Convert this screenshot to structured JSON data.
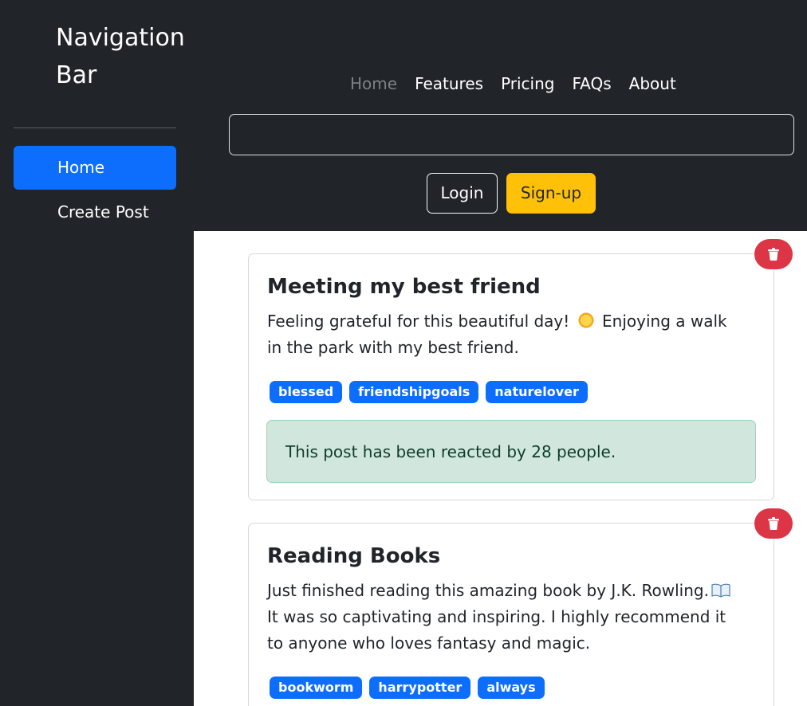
{
  "sidebar": {
    "brand": "Navigation Bar",
    "items": [
      {
        "label": "Home"
      },
      {
        "label": "Create Post"
      }
    ]
  },
  "header": {
    "nav": [
      "Home",
      "Features",
      "Pricing",
      "FAQs",
      "About"
    ],
    "search": {
      "value": "",
      "placeholder": ""
    },
    "login_label": "Login",
    "signup_label": "Sign-up"
  },
  "posts": [
    {
      "title": "Meeting my best friend",
      "body_before": "Feeling grateful for this beautiful day!",
      "emoji": "sun-icon",
      "body_after": "Enjoying a walk in the park with my best friend.",
      "tags": [
        "blessed",
        "friendshipgoals",
        "naturelover"
      ],
      "reactions_text": "This post has been reacted by 28 people."
    },
    {
      "title": "Reading Books",
      "body_before": "Just finished reading this amazing book by J.K. Rowling.",
      "emoji": "open-book-icon",
      "body_after": "It was so captivating and inspiring. I highly recommend it to anyone who loves fantasy and magic.",
      "tags": [
        "bookworm",
        "harrypotter",
        "always"
      ]
    }
  ],
  "colors": {
    "primary": "#0d6efd",
    "dark": "#212529",
    "warning": "#ffc107",
    "danger": "#dc3545",
    "success_bg": "#d1e7dd"
  }
}
